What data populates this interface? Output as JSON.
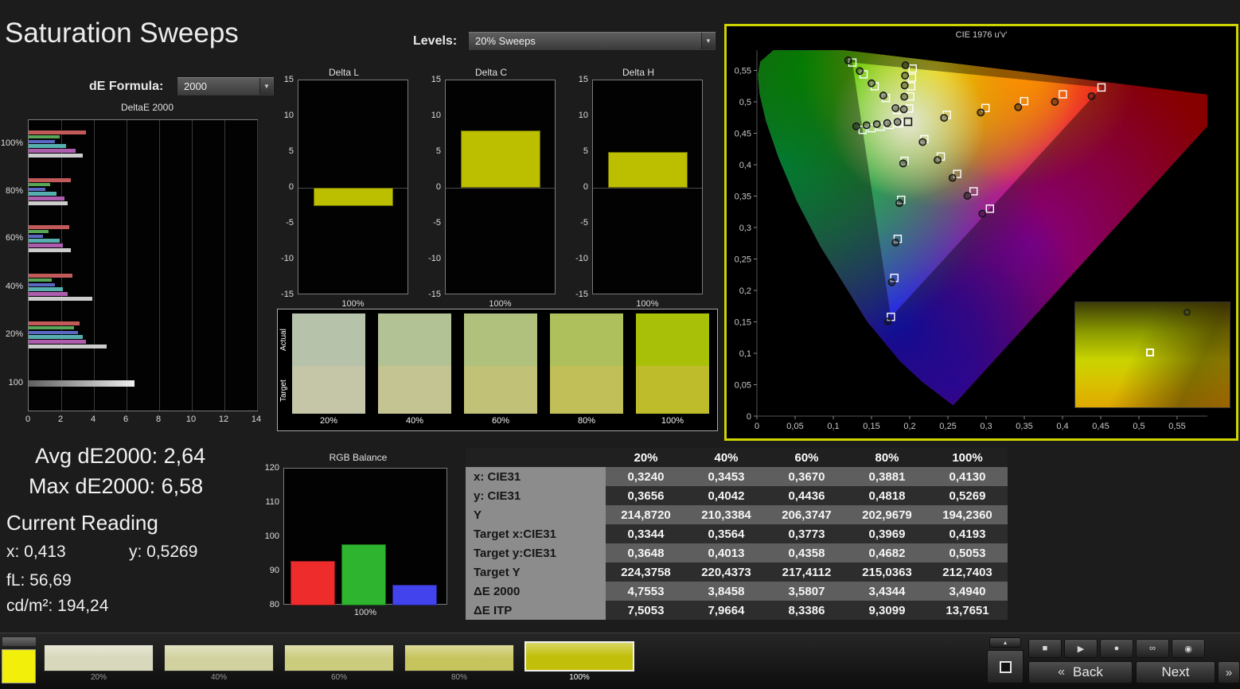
{
  "header": {
    "title": "Saturation Sweeps",
    "de_formula": {
      "label": "dE Formula:",
      "value": "2000"
    },
    "levels": {
      "label": "Levels:",
      "value": "20% Sweeps"
    },
    "icons": {
      "dropdown_arrow": "▼"
    }
  },
  "stats": {
    "avg": "Avg dE2000: 2,64",
    "max": "Max dE2000: 6,58",
    "current": {
      "title": "Current Reading",
      "x": "x: 0,413",
      "y": "y: 0,5269",
      "fl": "fL: 56,69",
      "cd": "cd/m²: 194,24"
    }
  },
  "swatch_compare": {
    "actual_label": "Actual",
    "target_label": "Target",
    "items": [
      {
        "label": "20%",
        "actual": "#b6c2a9",
        "target": "#c5c5a7"
      },
      {
        "label": "40%",
        "actual": "#b3c295",
        "target": "#c4c392"
      },
      {
        "label": "60%",
        "actual": "#b0c17d",
        "target": "#c2c178"
      },
      {
        "label": "80%",
        "actual": "#adc05b",
        "target": "#c1bf57"
      },
      {
        "label": "100%",
        "actual": "#a9c008",
        "target": "#bfbc2b"
      }
    ]
  },
  "table": {
    "header": [
      "",
      "20%",
      "40%",
      "60%",
      "80%",
      "100%"
    ],
    "rows": [
      {
        "label": "x: CIE31",
        "values": [
          "0,3240",
          "0,3453",
          "0,3670",
          "0,3881",
          "0,4130"
        ]
      },
      {
        "label": "y: CIE31",
        "values": [
          "0,3656",
          "0,4042",
          "0,4436",
          "0,4818",
          "0,5269"
        ]
      },
      {
        "label": "Y",
        "values": [
          "214,8720",
          "210,3384",
          "206,3747",
          "202,9679",
          "194,2360"
        ]
      },
      {
        "label": "Target x:CIE31",
        "values": [
          "0,3344",
          "0,3564",
          "0,3773",
          "0,3969",
          "0,4193"
        ]
      },
      {
        "label": "Target y:CIE31",
        "values": [
          "0,3648",
          "0,4013",
          "0,4358",
          "0,4682",
          "0,5053"
        ]
      },
      {
        "label": "Target Y",
        "values": [
          "224,3758",
          "220,4373",
          "217,4112",
          "215,0363",
          "212,7403"
        ]
      },
      {
        "label": "ΔE 2000",
        "values": [
          "4,7553",
          "3,8458",
          "3,5807",
          "3,4344",
          "3,4940"
        ]
      },
      {
        "label": "ΔE ITP",
        "values": [
          "7,5053",
          "7,9664",
          "8,3386",
          "9,3099",
          "13,7651"
        ]
      }
    ]
  },
  "toolbar": {
    "swatch_color": "#f2ef0a",
    "sweep_buttons": [
      {
        "label": "20%",
        "color": "#d8d8bd",
        "selected": false
      },
      {
        "label": "40%",
        "color": "#d2d2a0",
        "selected": false
      },
      {
        "label": "60%",
        "color": "#cccc7f",
        "selected": false
      },
      {
        "label": "80%",
        "color": "#c6c45c",
        "selected": false
      },
      {
        "label": "100%",
        "color": "#c1bf0a",
        "selected": true
      }
    ],
    "icons": [
      {
        "name": "stop",
        "glyph": "■"
      },
      {
        "name": "play",
        "glyph": "▶"
      },
      {
        "name": "record",
        "glyph": "●"
      },
      {
        "name": "continuous",
        "glyph": "∞"
      },
      {
        "name": "probe",
        "glyph": "◉"
      }
    ],
    "panel_toggle_glyph": "▴",
    "back_chevron": "«",
    "next_chevron": "»",
    "back_label": "Back",
    "next_label": "Next"
  },
  "chart_data": [
    {
      "id": "deltae_bars",
      "type": "bar",
      "orientation": "horizontal",
      "title": "DeltaE 2000",
      "xlim": [
        0,
        14
      ],
      "x_ticks": [
        0,
        2,
        4,
        6,
        8,
        10,
        12,
        14
      ],
      "colors": [
        "#c25a5a",
        "#58a758",
        "#5a68c4",
        "#56aeae",
        "#ae5cae",
        "#cccccc"
      ],
      "groups": [
        {
          "label": "100%",
          "values": [
            3.5,
            1.9,
            1.6,
            2.3,
            2.9,
            3.3
          ]
        },
        {
          "label": "80%",
          "values": [
            2.6,
            1.3,
            1.0,
            1.7,
            2.2,
            2.4
          ]
        },
        {
          "label": "60%",
          "values": [
            2.5,
            1.2,
            0.9,
            1.9,
            2.1,
            2.6
          ]
        },
        {
          "label": "40%",
          "values": [
            2.7,
            1.4,
            1.6,
            2.1,
            2.4,
            3.9
          ]
        },
        {
          "label": "20%",
          "values": [
            3.1,
            2.8,
            3.0,
            3.3,
            3.5,
            4.8
          ]
        },
        {
          "label": "100",
          "values": [
            6.5
          ]
        }
      ]
    },
    {
      "id": "delta_l",
      "type": "bar",
      "title": "Delta L",
      "ylim": [
        -15,
        15
      ],
      "y_ticks": [
        15,
        10,
        5,
        0,
        -5,
        -10,
        -15
      ],
      "x_label": "100%",
      "values": [
        -2.5
      ],
      "bar_color": "#bcbe00"
    },
    {
      "id": "delta_c",
      "type": "bar",
      "title": "Delta C",
      "ylim": [
        -15,
        15
      ],
      "y_ticks": [
        15,
        10,
        5,
        0,
        -5,
        -10,
        -15
      ],
      "x_label": "100%",
      "values": [
        8
      ],
      "bar_color": "#bcbe00"
    },
    {
      "id": "delta_h",
      "type": "bar",
      "title": "Delta H",
      "ylim": [
        -15,
        15
      ],
      "y_ticks": [
        15,
        10,
        5,
        0,
        -5,
        -10,
        -15
      ],
      "x_label": "100%",
      "values": [
        5
      ],
      "bar_color": "#bcbe00"
    },
    {
      "id": "rgb_balance",
      "type": "bar",
      "title": "RGB Balance",
      "ylim": [
        80,
        120
      ],
      "y_ticks": [
        120,
        110,
        100,
        90,
        80
      ],
      "x_label": "100%",
      "categories": [
        "Red",
        "Green",
        "Blue"
      ],
      "values": [
        93,
        98,
        86
      ],
      "colors": [
        "#ee2c2c",
        "#2eb42e",
        "#4343ee"
      ]
    },
    {
      "id": "cie",
      "type": "scatter",
      "title": "CIE 1976 u'v'",
      "xlim": [
        0,
        0.58
      ],
      "ylim": [
        0,
        0.58
      ],
      "tick_labels": [
        "0",
        "0,05",
        "0,1",
        "0,15",
        "0,2",
        "0,25",
        "0,3",
        "0,35",
        "0,4",
        "0,45",
        "0,5",
        "0,55"
      ],
      "white_point": [
        0.1978,
        0.4683
      ],
      "gamut_triangle": [
        [
          0.451,
          0.5229
        ],
        [
          0.125,
          0.5625
        ],
        [
          0.1754,
          0.1579
        ]
      ],
      "locus": [
        [
          0.2569,
          0.0172
        ],
        [
          0.2161,
          0.0549
        ],
        [
          0.1877,
          0.0871
        ],
        [
          0.1441,
          0.151
        ],
        [
          0.0828,
          0.2708
        ],
        [
          0.0521,
          0.3427
        ],
        [
          0.0282,
          0.4117
        ],
        [
          0.0119,
          0.4698
        ],
        [
          0.0035,
          0.5131
        ],
        [
          0.0014,
          0.5432
        ],
        [
          0.0046,
          0.5639
        ],
        [
          0.0231,
          0.5837
        ],
        [
          0.0501,
          0.5868
        ],
        [
          0.0792,
          0.5856
        ],
        [
          0.1127,
          0.5821
        ],
        [
          0.1531,
          0.5766
        ],
        [
          0.2026,
          0.5693
        ],
        [
          0.2623,
          0.5604
        ],
        [
          0.3316,
          0.5501
        ],
        [
          0.4035,
          0.5393
        ],
        [
          0.4692,
          0.5296
        ],
        [
          0.5202,
          0.5219
        ],
        [
          0.6234,
          0.5065
        ]
      ],
      "sweeps": [
        {
          "name": "red",
          "targets": [
            [
              0.2486,
              0.4793
            ],
            [
              0.2992,
              0.4902
            ],
            [
              0.3498,
              0.5011
            ],
            [
              0.4004,
              0.512
            ],
            [
              0.451,
              0.5229
            ]
          ],
          "measured": [
            [
              0.245,
              0.4745
            ],
            [
              0.293,
              0.483
            ],
            [
              0.342,
              0.4915
            ],
            [
              0.39,
              0.5
            ],
            [
              0.438,
              0.509
            ]
          ]
        },
        {
          "name": "green",
          "targets": [
            [
              0.1834,
              0.4871
            ],
            [
              0.1688,
              0.506
            ],
            [
              0.1542,
              0.5248
            ],
            [
              0.1396,
              0.5437
            ],
            [
              0.125,
              0.5625
            ]
          ],
          "measured": [
            [
              0.1815,
              0.49
            ],
            [
              0.1655,
              0.51
            ],
            [
              0.15,
              0.5295
            ],
            [
              0.1345,
              0.549
            ],
            [
              0.1195,
              0.566
            ]
          ]
        },
        {
          "name": "blue",
          "targets": [
            [
              0.1933,
              0.4062
            ],
            [
              0.1888,
              0.3441
            ],
            [
              0.1843,
              0.282
            ],
            [
              0.1799,
              0.22
            ],
            [
              0.1754,
              0.1579
            ]
          ],
          "measured": [
            [
              0.1915,
              0.402
            ],
            [
              0.1865,
              0.339
            ],
            [
              0.1815,
              0.276
            ],
            [
              0.1765,
              0.213
            ],
            [
              0.1715,
              0.1505
            ]
          ]
        },
        {
          "name": "cyan",
          "targets": [
            [
              0.1859,
              0.4657
            ],
            [
              0.174,
              0.4632
            ],
            [
              0.1621,
              0.4606
            ],
            [
              0.1503,
              0.4581
            ],
            [
              0.1384,
              0.4555
            ]
          ],
          "measured": [
            [
              0.184,
              0.468
            ],
            [
              0.1705,
              0.4662
            ],
            [
              0.157,
              0.4645
            ],
            [
              0.1435,
              0.4628
            ],
            [
              0.13,
              0.461
            ]
          ]
        },
        {
          "name": "magenta",
          "targets": [
            [
              0.2192,
              0.4406
            ],
            [
              0.2407,
              0.413
            ],
            [
              0.2621,
              0.3853
            ],
            [
              0.2836,
              0.3577
            ],
            [
              0.305,
              0.33
            ]
          ],
          "measured": [
            [
              0.217,
              0.436
            ],
            [
              0.2365,
              0.4075
            ],
            [
              0.256,
              0.379
            ],
            [
              0.2755,
              0.3505
            ],
            [
              0.295,
              0.322
            ]
          ]
        },
        {
          "name": "yellow",
          "targets": [
            [
              0.1994,
              0.4894
            ],
            [
              0.2007,
              0.5085
            ],
            [
              0.2019,
              0.5247
            ],
            [
              0.2029,
              0.5385
            ],
            [
              0.2039,
              0.5529
            ]
          ],
          "measured": [
            [
              0.1923,
              0.4882
            ],
            [
              0.1929,
              0.5081
            ],
            [
              0.1934,
              0.5261
            ],
            [
              0.1939,
              0.5417
            ],
            [
              0.1944,
              0.5581
            ]
          ]
        }
      ]
    }
  ]
}
